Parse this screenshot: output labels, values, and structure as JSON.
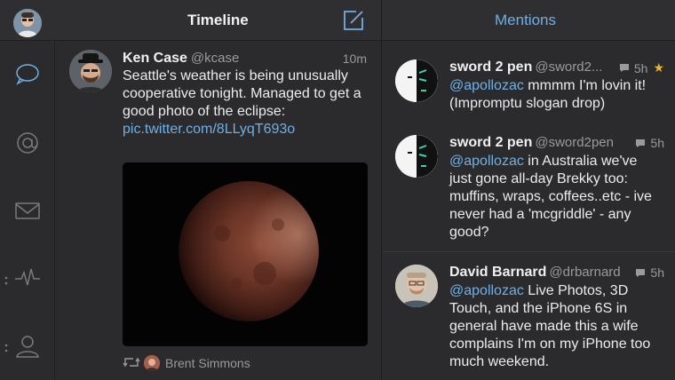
{
  "header": {
    "timeline_title": "Timeline",
    "mentions_title": "Mentions"
  },
  "icons": {
    "account": "avatar",
    "compose": "compose-icon",
    "rail": [
      "speech-bubble-icon",
      "at-sign-icon",
      "envelope-icon",
      "activity-icon",
      "profile-icon"
    ]
  },
  "colors": {
    "background": "#2b2b2e",
    "accent": "#6fb0e6",
    "star": "#f1b12b",
    "muted": "#9a9a9a"
  },
  "timeline": {
    "tweet": {
      "name": "Ken Case",
      "handle": "@kcase",
      "time": "10m",
      "text": "Seattle's weather is being unusually cooperative tonight. Managed to get a good photo of the eclipse: ",
      "link": "pic.twitter.com/8LLyqT693o",
      "retweeted_by": "Brent Simmons"
    }
  },
  "mentions": [
    {
      "name": "sword 2 pen",
      "handle": "@sword2...",
      "time": "5h",
      "starred": true,
      "mention": "@apollozac",
      "text": " mmmm I'm lovin it! (Impromptu slogan drop)"
    },
    {
      "name": "sword 2 pen",
      "handle": "@sword2pen",
      "time": "5h",
      "starred": false,
      "mention": "@apollozac",
      "text": " in Australia we've just gone all-day Brekky too: muffins, wraps, coffees..etc - ive never had a 'mcgriddle' - any good?"
    },
    {
      "name": "David Barnard",
      "handle": "@drbarnard",
      "time": "5h",
      "starred": false,
      "mention": "@apollozac",
      "text": " Live Photos, 3D Touch, and the iPhone 6S in general have made this a wife complains I'm on my iPhone too much weekend."
    }
  ]
}
